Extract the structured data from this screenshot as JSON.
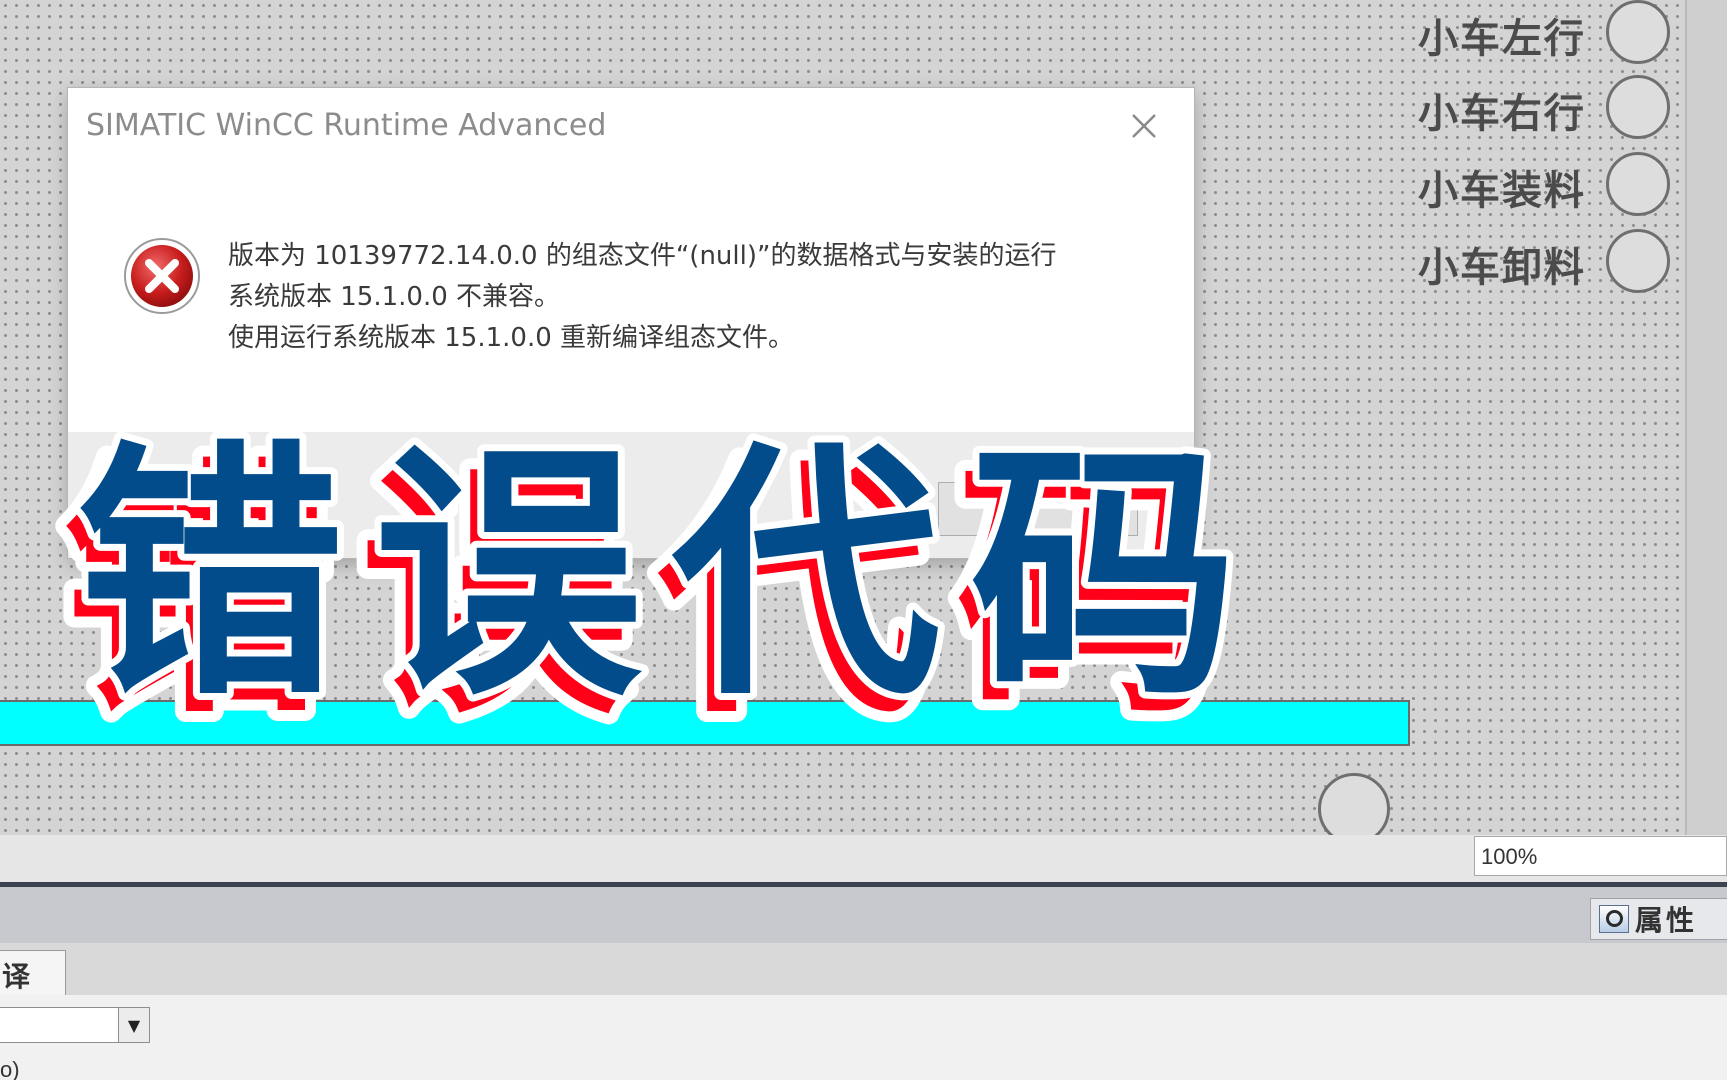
{
  "canvas": {
    "hmi_buttons": [
      {
        "label": "小车左行"
      },
      {
        "label": "小车右行"
      },
      {
        "label": "小车装料"
      },
      {
        "label": "小车卸料"
      }
    ],
    "belt_color": "#00ffff"
  },
  "zoom": {
    "value": "100%"
  },
  "inspector": {
    "properties_tab": "属性",
    "compile_tab": "译",
    "status_fragment": "o)"
  },
  "dialog": {
    "title": "SIMATIC WinCC Runtime Advanced",
    "message_lines": [
      "版本为 10139772.14.0.0 的组态文件“(null)”的数据格式与安装的运行",
      "系统版本 15.1.0.0 不兼容。",
      "使用运行系统版本 15.1.0.0 重新编译组态文件。"
    ],
    "icon": "error-icon",
    "close_icon": "close-icon"
  },
  "overlay": {
    "caption": "错误代码",
    "fill_color": "#034c8c",
    "shadow_color": "#ff0018",
    "outline_color": "#ffffff"
  }
}
